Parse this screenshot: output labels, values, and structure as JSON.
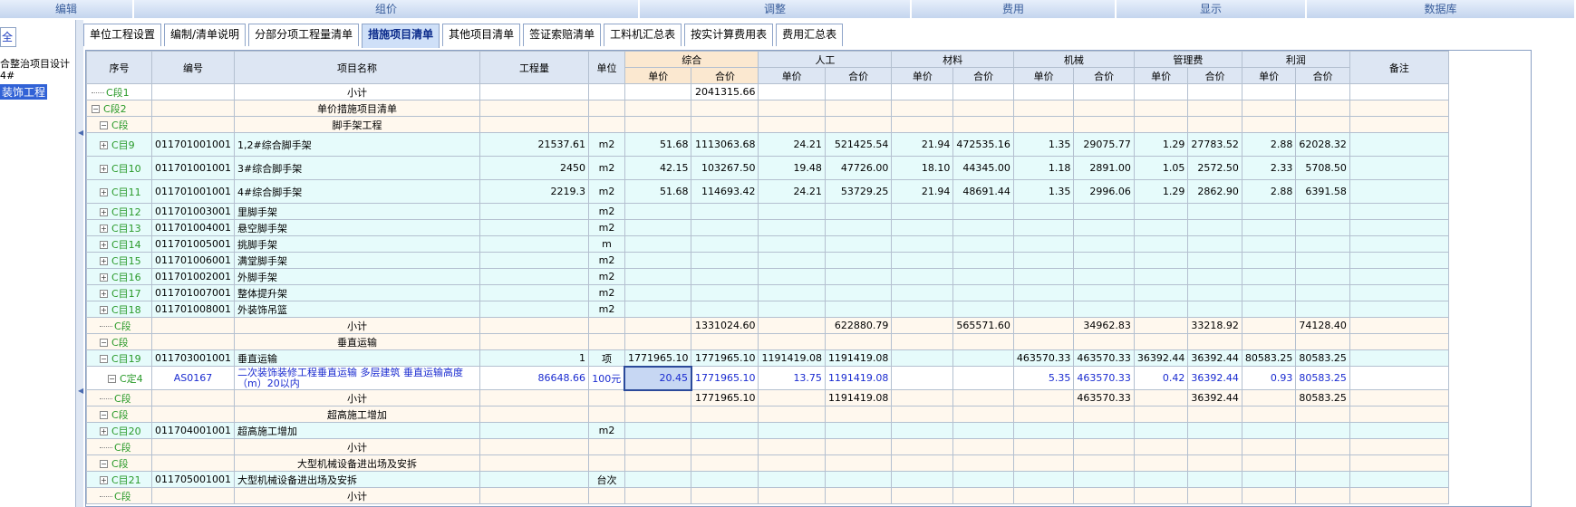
{
  "toolbar": [
    "编辑",
    "组价",
    "调整",
    "费用",
    "显示",
    "数据库"
  ],
  "left": {
    "all": "全",
    "tree": [
      "合整治项目设计",
      "4#",
      "装饰工程"
    ]
  },
  "tabs": [
    "单位工程设置",
    "编制/清单说明",
    "分部分项工程量清单",
    "措施项目清单",
    "其他项目清单",
    "签证索赔清单",
    "工料机汇总表",
    "按实计算费用表",
    "费用汇总表"
  ],
  "active_tab": 3,
  "headers": {
    "seq": "序号",
    "code": "编号",
    "name": "项目名称",
    "qty": "工程量",
    "unit": "单位",
    "groups": [
      "综合",
      "人工",
      "材料",
      "机械",
      "管理费",
      "利润"
    ],
    "sub": [
      "单价",
      "合价"
    ],
    "remark": "备注"
  },
  "rows": [
    {
      "k": "t",
      "seq": "C段1",
      "name": "小计",
      "zh_tot": "2041315.66",
      "indent": 0
    },
    {
      "k": "s",
      "seq": "C段2",
      "name": "单价措施项目清单",
      "exp": "−",
      "indent": 0
    },
    {
      "k": "s",
      "seq": "C段",
      "name": "脚手架工程",
      "exp": "−",
      "indent": 1
    },
    {
      "k": "c",
      "tall": true,
      "seq": "C目9",
      "code": "011701001001",
      "name": "1,2#综合脚手架",
      "qty": "21537.61",
      "unit": "m2",
      "v": [
        "51.68",
        "1113063.68",
        "24.21",
        "521425.54",
        "21.94",
        "472535.16",
        "1.35",
        "29075.77",
        "1.29",
        "27783.52",
        "2.88",
        "62028.32"
      ],
      "exp": "+",
      "indent": 1
    },
    {
      "k": "c",
      "tall": true,
      "seq": "C目10",
      "code": "011701001001",
      "name": "3#综合脚手架",
      "qty": "2450",
      "unit": "m2",
      "v": [
        "42.15",
        "103267.50",
        "19.48",
        "47726.00",
        "18.10",
        "44345.00",
        "1.18",
        "2891.00",
        "1.05",
        "2572.50",
        "2.33",
        "5708.50"
      ],
      "exp": "+",
      "indent": 1
    },
    {
      "k": "c",
      "tall": true,
      "seq": "C目11",
      "code": "011701001001",
      "name": "4#综合脚手架",
      "qty": "2219.3",
      "unit": "m2",
      "v": [
        "51.68",
        "114693.42",
        "24.21",
        "53729.25",
        "21.94",
        "48691.44",
        "1.35",
        "2996.06",
        "1.29",
        "2862.90",
        "2.88",
        "6391.58"
      ],
      "exp": "+",
      "indent": 1
    },
    {
      "k": "c",
      "seq": "C目12",
      "code": "011701003001",
      "name": "里脚手架",
      "unit": "m2",
      "exp": "+",
      "indent": 1
    },
    {
      "k": "c",
      "seq": "C目13",
      "code": "011701004001",
      "name": "悬空脚手架",
      "unit": "m2",
      "exp": "+",
      "indent": 1
    },
    {
      "k": "c",
      "seq": "C目14",
      "code": "011701005001",
      "name": "挑脚手架",
      "unit": "m",
      "exp": "+",
      "indent": 1
    },
    {
      "k": "c",
      "seq": "C目15",
      "code": "011701006001",
      "name": "满堂脚手架",
      "unit": "m2",
      "exp": "+",
      "indent": 1
    },
    {
      "k": "c",
      "seq": "C目16",
      "code": "011701002001",
      "name": "外脚手架",
      "unit": "m2",
      "exp": "+",
      "indent": 1
    },
    {
      "k": "c",
      "seq": "C目17",
      "code": "011701007001",
      "name": "整体提升架",
      "unit": "m2",
      "exp": "+",
      "indent": 1
    },
    {
      "k": "c",
      "seq": "C目18",
      "code": "011701008001",
      "name": "外装饰吊篮",
      "unit": "m2",
      "exp": "+",
      "indent": 1
    },
    {
      "k": "s",
      "seq": "C段",
      "name": "小计",
      "v": [
        "",
        "1331024.60",
        "",
        "622880.79",
        "",
        "565571.60",
        "",
        "34962.83",
        "",
        "33218.92",
        "",
        "74128.40"
      ],
      "indent": 1
    },
    {
      "k": "s",
      "seq": "C段",
      "name": "垂直运输",
      "exp": "−",
      "indent": 1
    },
    {
      "k": "c",
      "seq": "C目19",
      "code": "011703001001",
      "name": "垂直运输",
      "qty": "1",
      "unit": "项",
      "v": [
        "1771965.10",
        "1771965.10",
        "1191419.08",
        "1191419.08",
        "",
        "",
        "463570.33",
        "463570.33",
        "36392.44",
        "36392.44",
        "80583.25",
        "80583.25"
      ],
      "exp": "−",
      "indent": 1
    },
    {
      "k": "q",
      "tall": true,
      "seq": "C定4",
      "code": "AS0167",
      "name": "二次装饰装修工程垂直运输 多层建筑 垂直运输高度（m）20以内",
      "qty": "86648.66",
      "unit": "100元",
      "v": [
        "20.45",
        "1771965.10",
        "13.75",
        "1191419.08",
        "",
        "",
        "5.35",
        "463570.33",
        "0.42",
        "36392.44",
        "0.93",
        "80583.25"
      ],
      "exp": "−",
      "indent": 2
    },
    {
      "k": "s",
      "seq": "C段",
      "name": "小计",
      "v": [
        "",
        "1771965.10",
        "",
        "1191419.08",
        "",
        "",
        "",
        "463570.33",
        "",
        "36392.44",
        "",
        "80583.25"
      ],
      "indent": 1
    },
    {
      "k": "s",
      "seq": "C段",
      "name": "超高施工增加",
      "exp": "−",
      "indent": 1
    },
    {
      "k": "c",
      "seq": "C目20",
      "code": "011704001001",
      "name": "超高施工增加",
      "unit": "m2",
      "exp": "+",
      "indent": 1
    },
    {
      "k": "s",
      "seq": "C段",
      "name": "小计",
      "indent": 1
    },
    {
      "k": "s",
      "seq": "C段",
      "name": "大型机械设备进出场及安拆",
      "exp": "−",
      "indent": 1
    },
    {
      "k": "c",
      "seq": "C目21",
      "code": "011705001001",
      "name": "大型机械设备进出场及安拆",
      "unit": "台次",
      "exp": "+",
      "indent": 1
    },
    {
      "k": "s",
      "seq": "C段",
      "name": "小计",
      "indent": 1
    }
  ]
}
